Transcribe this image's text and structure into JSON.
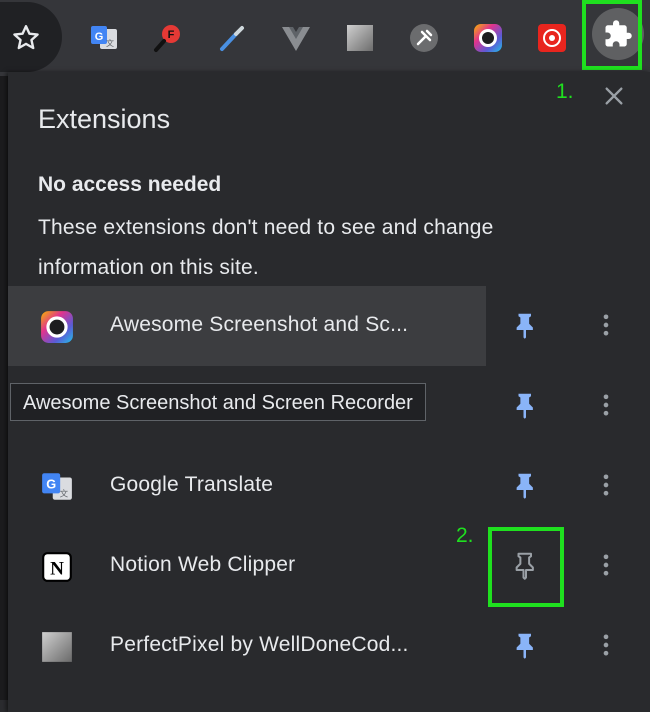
{
  "toolbar": {
    "icons": [
      {
        "name": "bookmark-star-icon"
      },
      {
        "name": "google-translate-icon"
      },
      {
        "name": "fontface-ninja-icon"
      },
      {
        "name": "color-picker-icon"
      },
      {
        "name": "vue-devtools-icon"
      },
      {
        "name": "perfectpixel-icon"
      },
      {
        "name": "tools-icon"
      },
      {
        "name": "awesome-screenshot-icon"
      },
      {
        "name": "red-recorder-icon"
      },
      {
        "name": "puzzle-extensions-icon"
      }
    ]
  },
  "annotations": {
    "step1": "1.",
    "step2": "2."
  },
  "panel": {
    "title": "Extensions",
    "section_heading": "No access needed",
    "section_description": "These extensions don't need to see and change information on this site.",
    "tooltip": "Awesome Screenshot and Screen Recorder",
    "items": [
      {
        "label": "Awesome Screenshot and Sc...",
        "pinned": true,
        "icon": "awesome-screenshot-icon"
      },
      {
        "label": "",
        "pinned": true,
        "icon": ""
      },
      {
        "label": "Google Translate",
        "pinned": true,
        "icon": "google-translate-icon"
      },
      {
        "label": "Notion Web Clipper",
        "pinned": false,
        "icon": "notion-icon"
      },
      {
        "label": "PerfectPixel by WellDoneCod...",
        "pinned": true,
        "icon": "perfectpixel-icon"
      }
    ]
  },
  "colors": {
    "accent_pin": "#8ab4f8",
    "unpinned": "#9aa0a6",
    "highlight": "#1fe01f",
    "panel_bg": "#292a2d"
  }
}
